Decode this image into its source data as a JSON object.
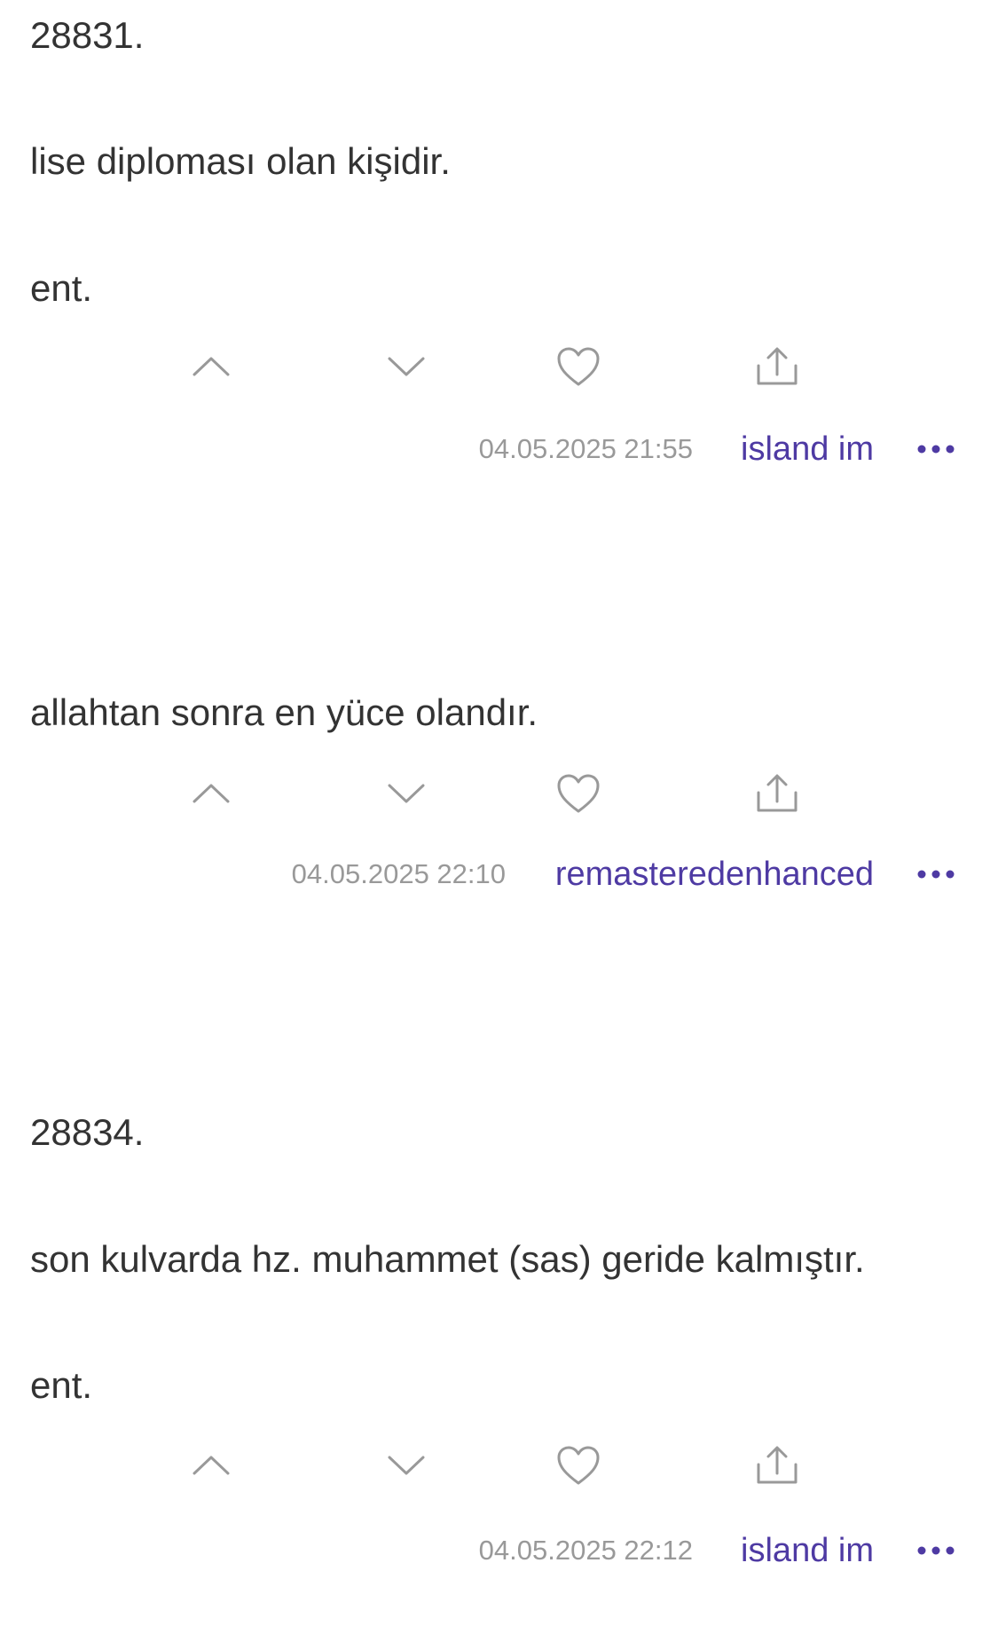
{
  "entries": [
    {
      "paragraphs": [
        "28831.",
        "lise diploması olan kişidir.",
        "ent."
      ],
      "date": "04.05.2025 21:55",
      "author": "island im"
    },
    {
      "paragraphs": [
        "allahtan sonra en yüce olandır."
      ],
      "date": "04.05.2025 22:10",
      "author": "remasteredenhanced"
    },
    {
      "paragraphs": [
        "28834.",
        "son kulvarda hz. muhammet (sas) geride kalmıştır.",
        "ent."
      ],
      "date": "04.05.2025 22:12",
      "author": "island im"
    }
  ],
  "icons": {
    "upvote": "chevron-up-icon",
    "downvote": "chevron-down-icon",
    "favorite": "heart-icon",
    "share": "share-icon",
    "more": "more-dots-icon"
  },
  "colors": {
    "text": "#333333",
    "icon": "#999999",
    "date": "#999999",
    "author": "#4e3aa3"
  }
}
